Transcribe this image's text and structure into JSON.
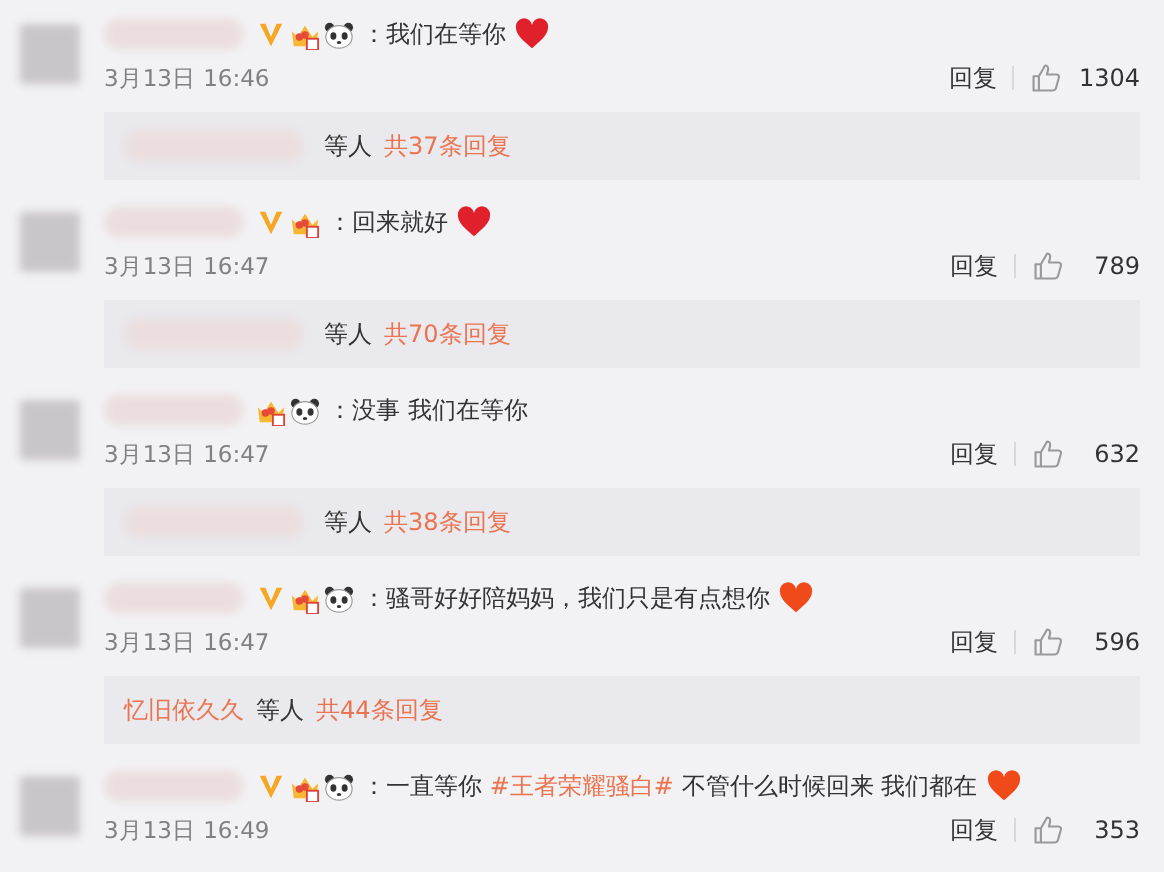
{
  "comments": [
    {
      "badges": [
        {
          "kind": "v"
        },
        {
          "kind": "crown"
        },
        {
          "kind": "panda"
        }
      ],
      "text": [
        {
          "kind": "plain",
          "text": "：我们在等你"
        }
      ],
      "heart": {
        "color": "#e0202a"
      },
      "time": "3月13日 16:46",
      "reply": "回复",
      "likes": "1304",
      "thread": {
        "text": "等人",
        "link": "共37条回复"
      }
    },
    {
      "badges": [
        {
          "kind": "v"
        },
        {
          "kind": "crown"
        }
      ],
      "text": [
        {
          "kind": "plain",
          "text": "：回来就好"
        }
      ],
      "heart": {
        "color": "#e0202a"
      },
      "time": "3月13日 16:47",
      "reply": "回复",
      "likes": "789",
      "thread": {
        "text": "等人",
        "link": "共70条回复"
      }
    },
    {
      "badges": [
        {
          "kind": "crown"
        },
        {
          "kind": "panda"
        }
      ],
      "text": [
        {
          "kind": "plain",
          "text": "：没事 我们在等你"
        }
      ],
      "time": "3月13日 16:47",
      "reply": "回复",
      "likes": "632",
      "thread": {
        "text": "等人",
        "link": "共38条回复"
      }
    },
    {
      "badges": [
        {
          "kind": "v"
        },
        {
          "kind": "crown"
        },
        {
          "kind": "panda"
        }
      ],
      "text": [
        {
          "kind": "plain",
          "text": "：骚哥好好陪妈妈，我们只是有点想你"
        }
      ],
      "heart": {
        "color": "#f04a1a"
      },
      "time": "3月13日 16:47",
      "reply": "回复",
      "likes": "596",
      "thread": {
        "name": "忆旧依久久",
        "text": "等人",
        "link": "共44条回复"
      }
    },
    {
      "badges": [
        {
          "kind": "v"
        },
        {
          "kind": "crown"
        },
        {
          "kind": "panda"
        }
      ],
      "text": [
        {
          "kind": "plain",
          "text": "：一直等你 "
        },
        {
          "kind": "hashtag",
          "text": "#王者荣耀骚白#"
        },
        {
          "kind": "plain",
          "text": " 不管什么时候回来 我们都在"
        }
      ],
      "heart": {
        "color": "#f04a1a"
      },
      "time": "3月13日 16:49",
      "reply": "回复",
      "likes": "353"
    }
  ]
}
